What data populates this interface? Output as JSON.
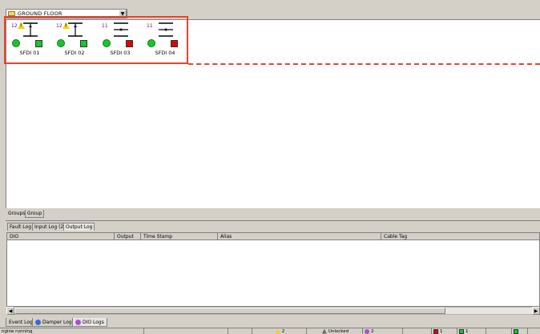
{
  "floor_select": {
    "value": "GROUND FLOOR",
    "icon": "folder-icon"
  },
  "devices": [
    {
      "label": "SFDI 01",
      "num": "12",
      "warning": true,
      "position": "open",
      "led": "green",
      "square_color": "#18c62a"
    },
    {
      "label": "SFDI 02",
      "num": "12",
      "warning": true,
      "position": "open",
      "led": "green",
      "square_color": "#18c62a"
    },
    {
      "label": "SFDI 03",
      "num": "11",
      "warning": false,
      "position": "closed",
      "led": "green",
      "square_color": "#e00000"
    },
    {
      "label": "SFDI 04",
      "num": "11",
      "warning": false,
      "position": "closed",
      "led": "green",
      "square_color": "#e00000"
    }
  ],
  "groups": {
    "label": "Groups",
    "tab": "Group"
  },
  "log_tabs": [
    "Fault Log",
    "Input Log (2)",
    "Output Log"
  ],
  "log_columns": [
    "DIO",
    "Output",
    "Time Stamp",
    "Alias",
    "Cable Tag"
  ],
  "bottom_tabs": [
    {
      "label": "Event Log",
      "icon": ""
    },
    {
      "label": "Damper Logs",
      "icon": "damper-icon"
    },
    {
      "label": "DIO Logs",
      "icon": "dio-icon"
    }
  ],
  "status": {
    "message": "ngine running",
    "warnings": "2",
    "lock": "Unlocked",
    "dio": "2",
    "red_count": "1",
    "green_count": "1"
  },
  "colors": {
    "highlight": "#e8432b",
    "green": "#18c62a",
    "red": "#e00000",
    "warning": "#f2d400"
  }
}
